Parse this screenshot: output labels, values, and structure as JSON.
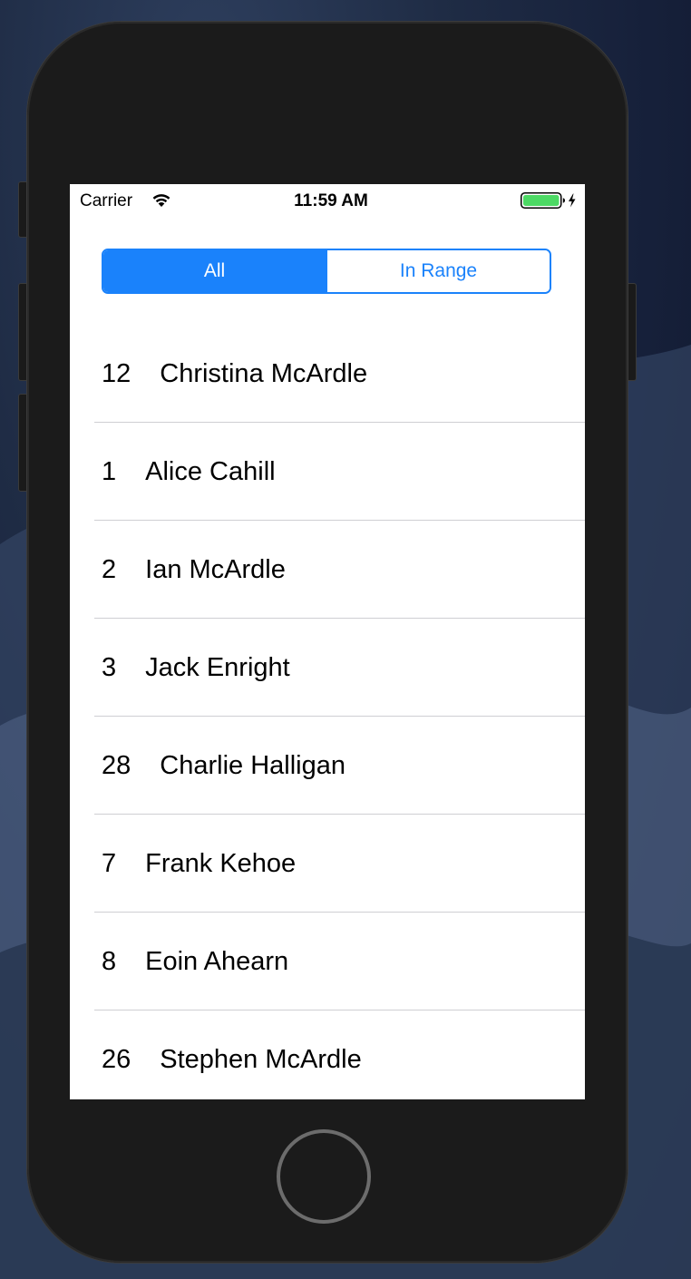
{
  "status_bar": {
    "carrier": "Carrier",
    "time": "11:59 AM",
    "wifi_icon": "wifi-icon",
    "battery_icon": "battery-charging-icon",
    "battery_color": "#4cd964"
  },
  "segmented_control": {
    "accent_color": "#1a82fb",
    "segments": [
      {
        "label": "All",
        "selected": true
      },
      {
        "label": "In Range",
        "selected": false
      }
    ]
  },
  "list": {
    "rows": [
      {
        "number": "12",
        "name": "Christina McArdle"
      },
      {
        "number": "1",
        "name": "Alice Cahill"
      },
      {
        "number": "2",
        "name": "Ian McArdle"
      },
      {
        "number": "3",
        "name": "Jack Enright"
      },
      {
        "number": "28",
        "name": "Charlie Halligan"
      },
      {
        "number": "7",
        "name": "Frank Kehoe"
      },
      {
        "number": "8",
        "name": "Eoin Ahearn"
      },
      {
        "number": "26",
        "name": "Stephen McArdle"
      }
    ]
  }
}
